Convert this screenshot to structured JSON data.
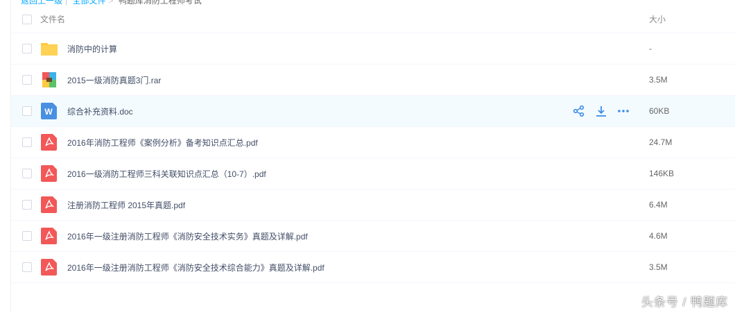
{
  "breadcrumb": {
    "back": "返回上一级",
    "all_files": "全部文件",
    "current": "鸭题库消防工程师考试"
  },
  "header": {
    "name_col": "文件名",
    "size_col": "大小"
  },
  "files": [
    {
      "name": "消防中的计算",
      "size": "-",
      "icon": "folder-icon"
    },
    {
      "name": "2015一级消防真题3门.rar",
      "size": "3.5M",
      "icon": "rar-archive-icon"
    },
    {
      "name": "综合补充资料.doc",
      "size": "60KB",
      "icon": "word-doc-icon"
    },
    {
      "name": "2016年消防工程师《案例分析》备考知识点汇总.pdf",
      "size": "24.7M",
      "icon": "pdf-icon"
    },
    {
      "name": "2016一级消防工程师三科关联知识点汇总（10-7）.pdf",
      "size": "146KB",
      "icon": "pdf-icon"
    },
    {
      "name": "注册消防工程师 2015年真题.pdf",
      "size": "6.4M",
      "icon": "pdf-icon"
    },
    {
      "name": "2016年一级注册消防工程师《消防安全技术实务》真题及详解.pdf",
      "size": "4.6M",
      "icon": "pdf-icon"
    },
    {
      "name": "2016年一级注册消防工程师《消防安全技术综合能力》真题及详解.pdf",
      "size": "3.5M",
      "icon": "pdf-icon"
    }
  ],
  "row_actions": [
    "share-icon",
    "download-icon",
    "more-icon"
  ],
  "watermark": "头条号 / 鸭题库",
  "colors": {
    "accent": "#09aaff",
    "folder": "#ffd256",
    "pdf": "#f25858",
    "word": "#4a90e2",
    "action": "#3b8ee8"
  }
}
